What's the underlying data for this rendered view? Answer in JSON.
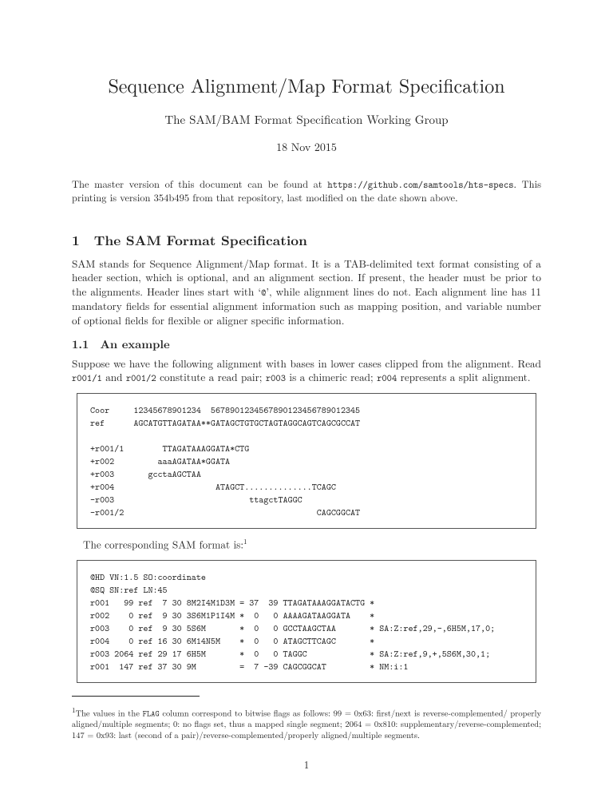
{
  "title": "Sequence Alignment/Map Format Specification",
  "subtitle": "The SAM/BAM Format Specification Working Group",
  "date": "18 Nov 2015",
  "intro_line1_a": "The master version of this document can be found at ",
  "intro_line1_tt": "https://github.com/samtools/hts-specs",
  "intro_line1_b": ". This printing is version 354b495 from that repository, last modified on the date shown above.",
  "section1_num": "1",
  "section1_title": "The SAM Format Specification",
  "section1_body_a": "SAM stands for Sequence Alignment/Map format. It is a TAB-delimited text format consisting of a header section, which is optional, and an alignment section. If present, the header must be prior to the alignments. Header lines start with ‘",
  "section1_body_at": "@",
  "section1_body_b": "’, while alignment lines do not. Each alignment line has 11 mandatory fields for essential alignment information such as mapping position, and variable number of optional fields for flexible or aligner specific information.",
  "subsection11_num": "1.1",
  "subsection11_title": "An example",
  "subsection11_body_a": "Suppose we have the following alignment with bases in lower cases clipped from the alignment. Read ",
  "subsection11_tt1": "r001/1",
  "subsection11_body_b": " and ",
  "subsection11_tt2": "r001/2",
  "subsection11_body_c": " constitute a read pair; ",
  "subsection11_tt3": "r003",
  "subsection11_body_d": " is a chimeric read; ",
  "subsection11_tt4": "r004",
  "subsection11_body_e": " represents a split alignment.",
  "codebox1": "Coor     12345678901234  5678901234567890123456789012345\nref      AGCATGTTAGATAA**GATAGCTGTGCTAGTAGGCAGTCAGCGCCAT\n\n+r001/1        TTAGATAAAGGATA*CTG\n+r002         aaaAGATAA*GGATA\n+r003       gcctaAGCTAA\n+r004                     ATAGCT..............TCAGC\n-r003                            ttagctTAGGC\n-r001/2                                        CAGCGGCAT",
  "between_text_a": "The corresponding SAM format is:",
  "between_sup": "1",
  "codebox2": "@HD VN:1.5 SO:coordinate\n@SQ SN:ref LN:45\nr001   99 ref  7 30 8M2I4M1D3M = 37  39 TTAGATAAAGGATACTG *\nr002    0 ref  9 30 3S6M1P1I4M *  0   0 AAAAGATAAGGATA    *\nr003    0 ref  9 30 5S6M       *  0   0 GCCTAAGCTAA       * SA:Z:ref,29,-,6H5M,17,0;\nr004    0 ref 16 30 6M14N5M    *  0   0 ATAGCTTCAGC       *\nr003 2064 ref 29 17 6H5M       *  0   0 TAGGC             * SA:Z:ref,9,+,5S6M,30,1;\nr001  147 ref 37 30 9M         =  7 -39 CAGCGGCAT         * NM:i:1",
  "footnote_marker": "1",
  "footnote_a": "The values in the ",
  "footnote_tt": "FLAG",
  "footnote_b": " column correspond to bitwise flags as follows: 99 = 0x63: first/next is reverse-complemented/ properly aligned/multiple segments; 0: no flags set, thus a mapped single segment; 2064 = 0x810: supplementary/reverse-complemented; 147 = 0x93: last (second of a pair)/reverse-complemented/properly aligned/multiple segments.",
  "page_number": "1"
}
